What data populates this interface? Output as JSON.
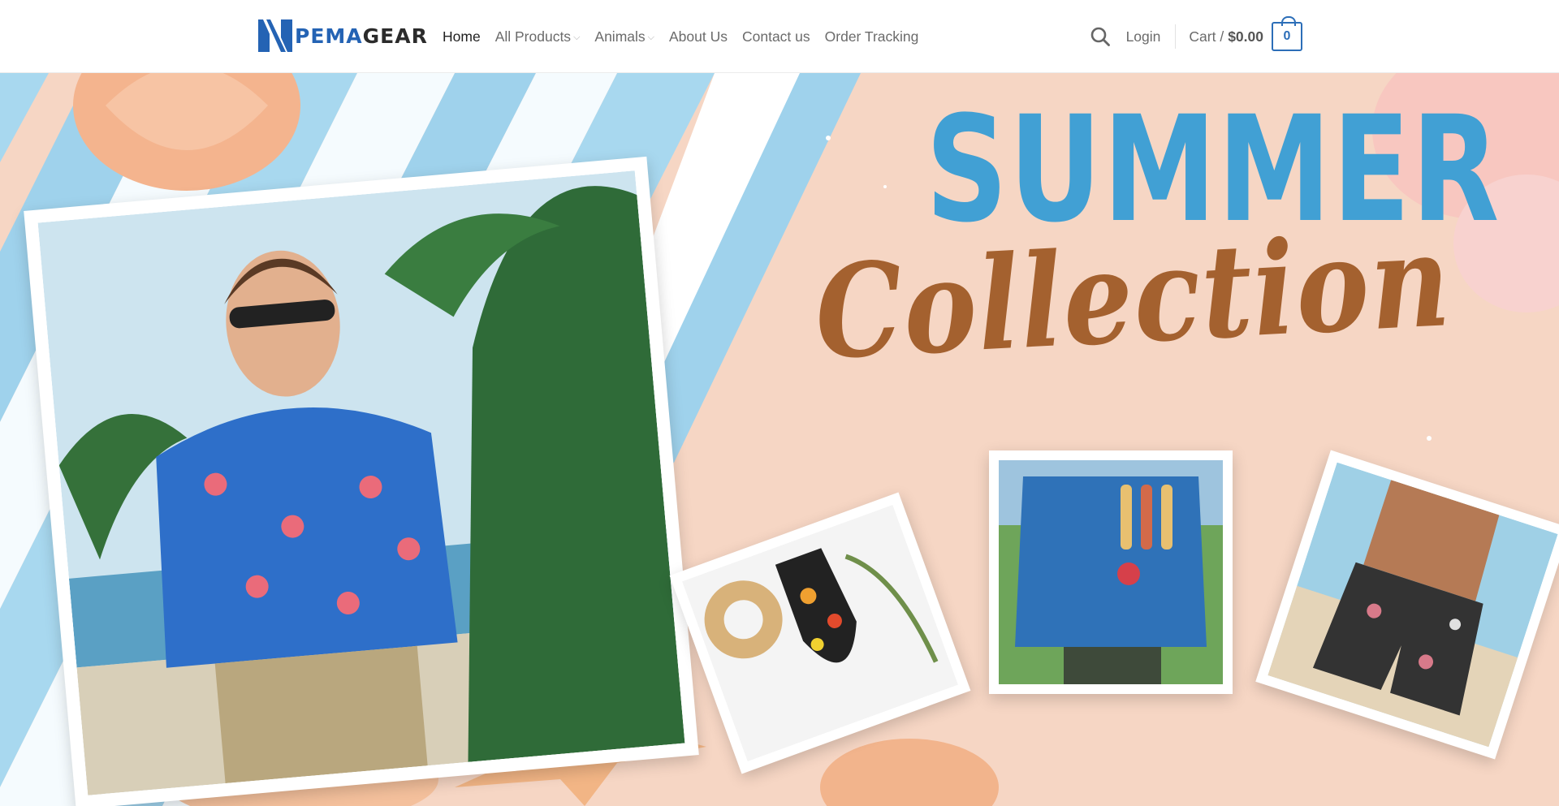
{
  "brand": {
    "logo_part1": "PEMA",
    "logo_part2": "GEAR",
    "logo_color": "#2463b4"
  },
  "nav": {
    "items": [
      {
        "label": "Home",
        "active": true,
        "dropdown": false
      },
      {
        "label": "All Products",
        "active": false,
        "dropdown": true
      },
      {
        "label": "Animals",
        "active": false,
        "dropdown": true
      },
      {
        "label": "About Us",
        "active": false,
        "dropdown": false
      },
      {
        "label": "Contact us",
        "active": false,
        "dropdown": false
      },
      {
        "label": "Order Tracking",
        "active": false,
        "dropdown": false
      }
    ]
  },
  "header_right": {
    "search_icon": "search-icon",
    "login_label": "Login",
    "cart_label": "Cart /",
    "cart_amount": "$0.00",
    "cart_count": "0",
    "accent_color": "#2c6eb8"
  },
  "hero": {
    "title_line1": "SUMMER",
    "title_line2": "Collection",
    "title_line1_color": "#41a0d4",
    "title_line2_color": "#a4612f",
    "background_color": "#f6d6c4"
  }
}
